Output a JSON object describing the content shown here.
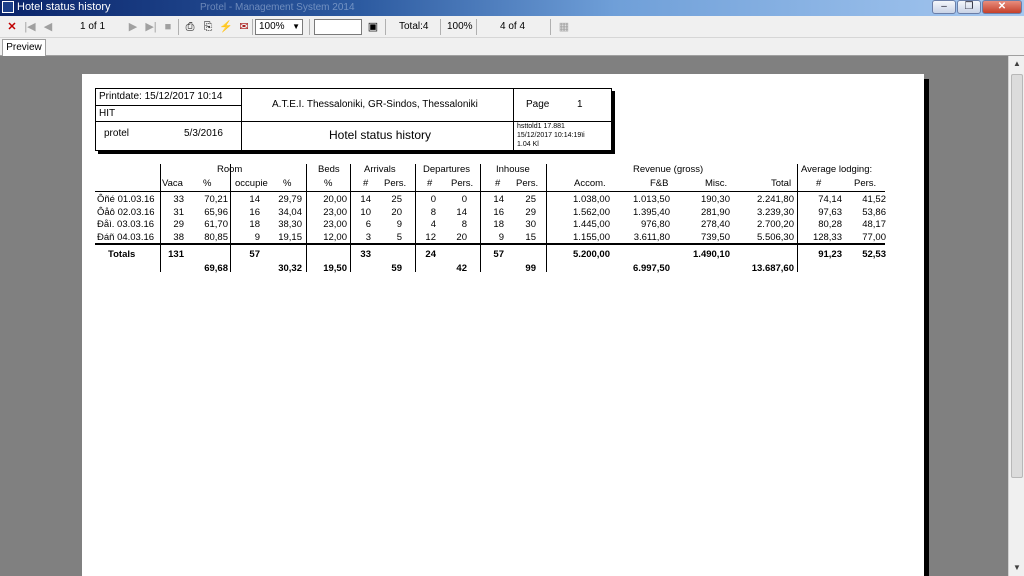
{
  "window": {
    "title": "Hotel status history",
    "faded_title": "Protel - Management System 2014"
  },
  "toolbar": {
    "page_indicator": "1 of 1",
    "zoom": "100%",
    "search_value": "",
    "total": "Total:4",
    "percent": "100%",
    "records": "4 of 4"
  },
  "tabs": {
    "preview": "Preview"
  },
  "report": {
    "printdate": "Printdate: 15/12/2017  10:14",
    "hit": "HIT",
    "protel": "protel",
    "version_date": "5/3/2016",
    "hotel": "A.T.E.I. Thessaloniki, GR-Sindos, Thessaloniki",
    "title": "Hotel status history",
    "page_label": "Page",
    "page_number": "1",
    "meta_line1": "hsttold1 17.881",
    "meta_line2": "15/12/2017  10:14:19ïi",
    "meta_line3": "1.04  Kl",
    "groups": {
      "room": "Room",
      "beds": "Beds",
      "arrivals": "Arrivals",
      "departures": "Departures",
      "inhouse": "Inhouse",
      "revenue": "Revenue  (gross)",
      "avg": "Average lodging:"
    },
    "cols": {
      "vaca": "Vaca",
      "pct1": "%",
      "occupie": "occupie",
      "pct2": "%",
      "beds_pct": "%",
      "arr_n": "#",
      "arr_pers": "Pers.",
      "dep_n": "#",
      "dep_pers": "Pers.",
      "inh_n": "#",
      "inh_pers": "Pers.",
      "accom": "Accom.",
      "fb": "F&B",
      "misc": "Misc.",
      "total": "Total",
      "avg_n": "#",
      "avg_pers": "Pers."
    },
    "rows": [
      {
        "day": "Ôñé 01.03.16",
        "vaca": "33",
        "pct1": "70,21",
        "occ": "14",
        "pct2": "29,79",
        "beds": "20,00",
        "arr_n": "14",
        "arr_p": "25",
        "dep_n": "0",
        "dep_p": "0",
        "inh_n": "14",
        "inh_p": "25",
        "accom": "1.038,00",
        "fb": "1.013,50",
        "misc": "190,30",
        "total": "2.241,80",
        "avg_n": "74,14",
        "avg_p": "41,52"
      },
      {
        "day": "Ôåô 02.03.16",
        "vaca": "31",
        "pct1": "65,96",
        "occ": "16",
        "pct2": "34,04",
        "beds": "23,00",
        "arr_n": "10",
        "arr_p": "20",
        "dep_n": "8",
        "dep_p": "14",
        "inh_n": "16",
        "inh_p": "29",
        "accom": "1.562,00",
        "fb": "1.395,40",
        "misc": "281,90",
        "total": "3.239,30",
        "avg_n": "97,63",
        "avg_p": "53,86"
      },
      {
        "day": "Ðåì. 03.03.16",
        "vaca": "29",
        "pct1": "61,70",
        "occ": "18",
        "pct2": "38,30",
        "beds": "23,00",
        "arr_n": "6",
        "arr_p": "9",
        "dep_n": "4",
        "dep_p": "8",
        "inh_n": "18",
        "inh_p": "30",
        "accom": "1.445,00",
        "fb": "976,80",
        "misc": "278,40",
        "total": "2.700,20",
        "avg_n": "80,28",
        "avg_p": "48,17"
      },
      {
        "day": "Ðáñ 04.03.16",
        "vaca": "38",
        "pct1": "80,85",
        "occ": "9",
        "pct2": "19,15",
        "beds": "12,00",
        "arr_n": "3",
        "arr_p": "5",
        "dep_n": "12",
        "dep_p": "20",
        "inh_n": "9",
        "inh_p": "15",
        "accom": "1.155,00",
        "fb": "3.611,80",
        "misc": "739,50",
        "total": "5.506,30",
        "avg_n": "128,33",
        "avg_p": "77,00"
      }
    ],
    "totals": {
      "label": "Totals",
      "vaca": "131",
      "pct1": "69,68",
      "occ": "57",
      "pct2": "30,32",
      "beds": "19,50",
      "arr_n": "33",
      "arr_p": "59",
      "dep_n": "24",
      "dep_p": "42",
      "inh_n": "57",
      "inh_p": "99",
      "accom": "5.200,00",
      "fb": "6.997,50",
      "misc": "1.490,10",
      "total": "13.687,60",
      "avg_n": "91,23",
      "avg_p": "52,53"
    }
  }
}
